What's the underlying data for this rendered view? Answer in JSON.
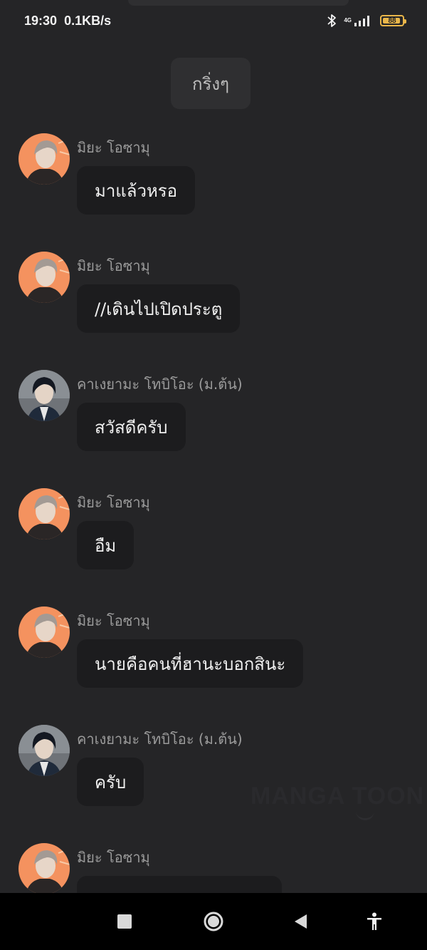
{
  "status_bar": {
    "time": "19:30",
    "speed": "0.1KB/s",
    "network": "4G",
    "battery": "88"
  },
  "system_message": "กริ่งๆ",
  "messages": [
    {
      "sender": "มิยะ โอซามุ",
      "text": "มาแล้วหรอ",
      "avatar": "osamu"
    },
    {
      "sender": "มิยะ โอซามุ",
      "text": "//เดินไปเปิดประตู",
      "avatar": "osamu"
    },
    {
      "sender": "คาเงยามะ โทบิโอะ (ม.ต้น)",
      "text": "สวัสดีครับ",
      "avatar": "kageyama"
    },
    {
      "sender": "มิยะ โอซามุ",
      "text": "อืม",
      "avatar": "osamu"
    },
    {
      "sender": "มิยะ โอซามุ",
      "text": "นายคือคนที่ฮานะบอกสินะ",
      "avatar": "osamu"
    },
    {
      "sender": "คาเงยามะ โทบิโอะ (ม.ต้น)",
      "text": "ครับ",
      "avatar": "kageyama"
    },
    {
      "sender": "มิยะ โอซามุ",
      "text": "",
      "avatar": "osamu"
    }
  ],
  "watermark": "MANGA TOON",
  "nav": {
    "recents_icon": "square-icon",
    "home_icon": "circle-icon",
    "back_icon": "triangle-back-icon",
    "accessibility_icon": "accessibility-icon"
  },
  "colors": {
    "background": "#252527",
    "bubble": "#1c1c1e",
    "osamu_avatar_bg": "#f4925f",
    "kageyama_avatar_bg": "#6f7378",
    "battery": "#e9b64a"
  }
}
